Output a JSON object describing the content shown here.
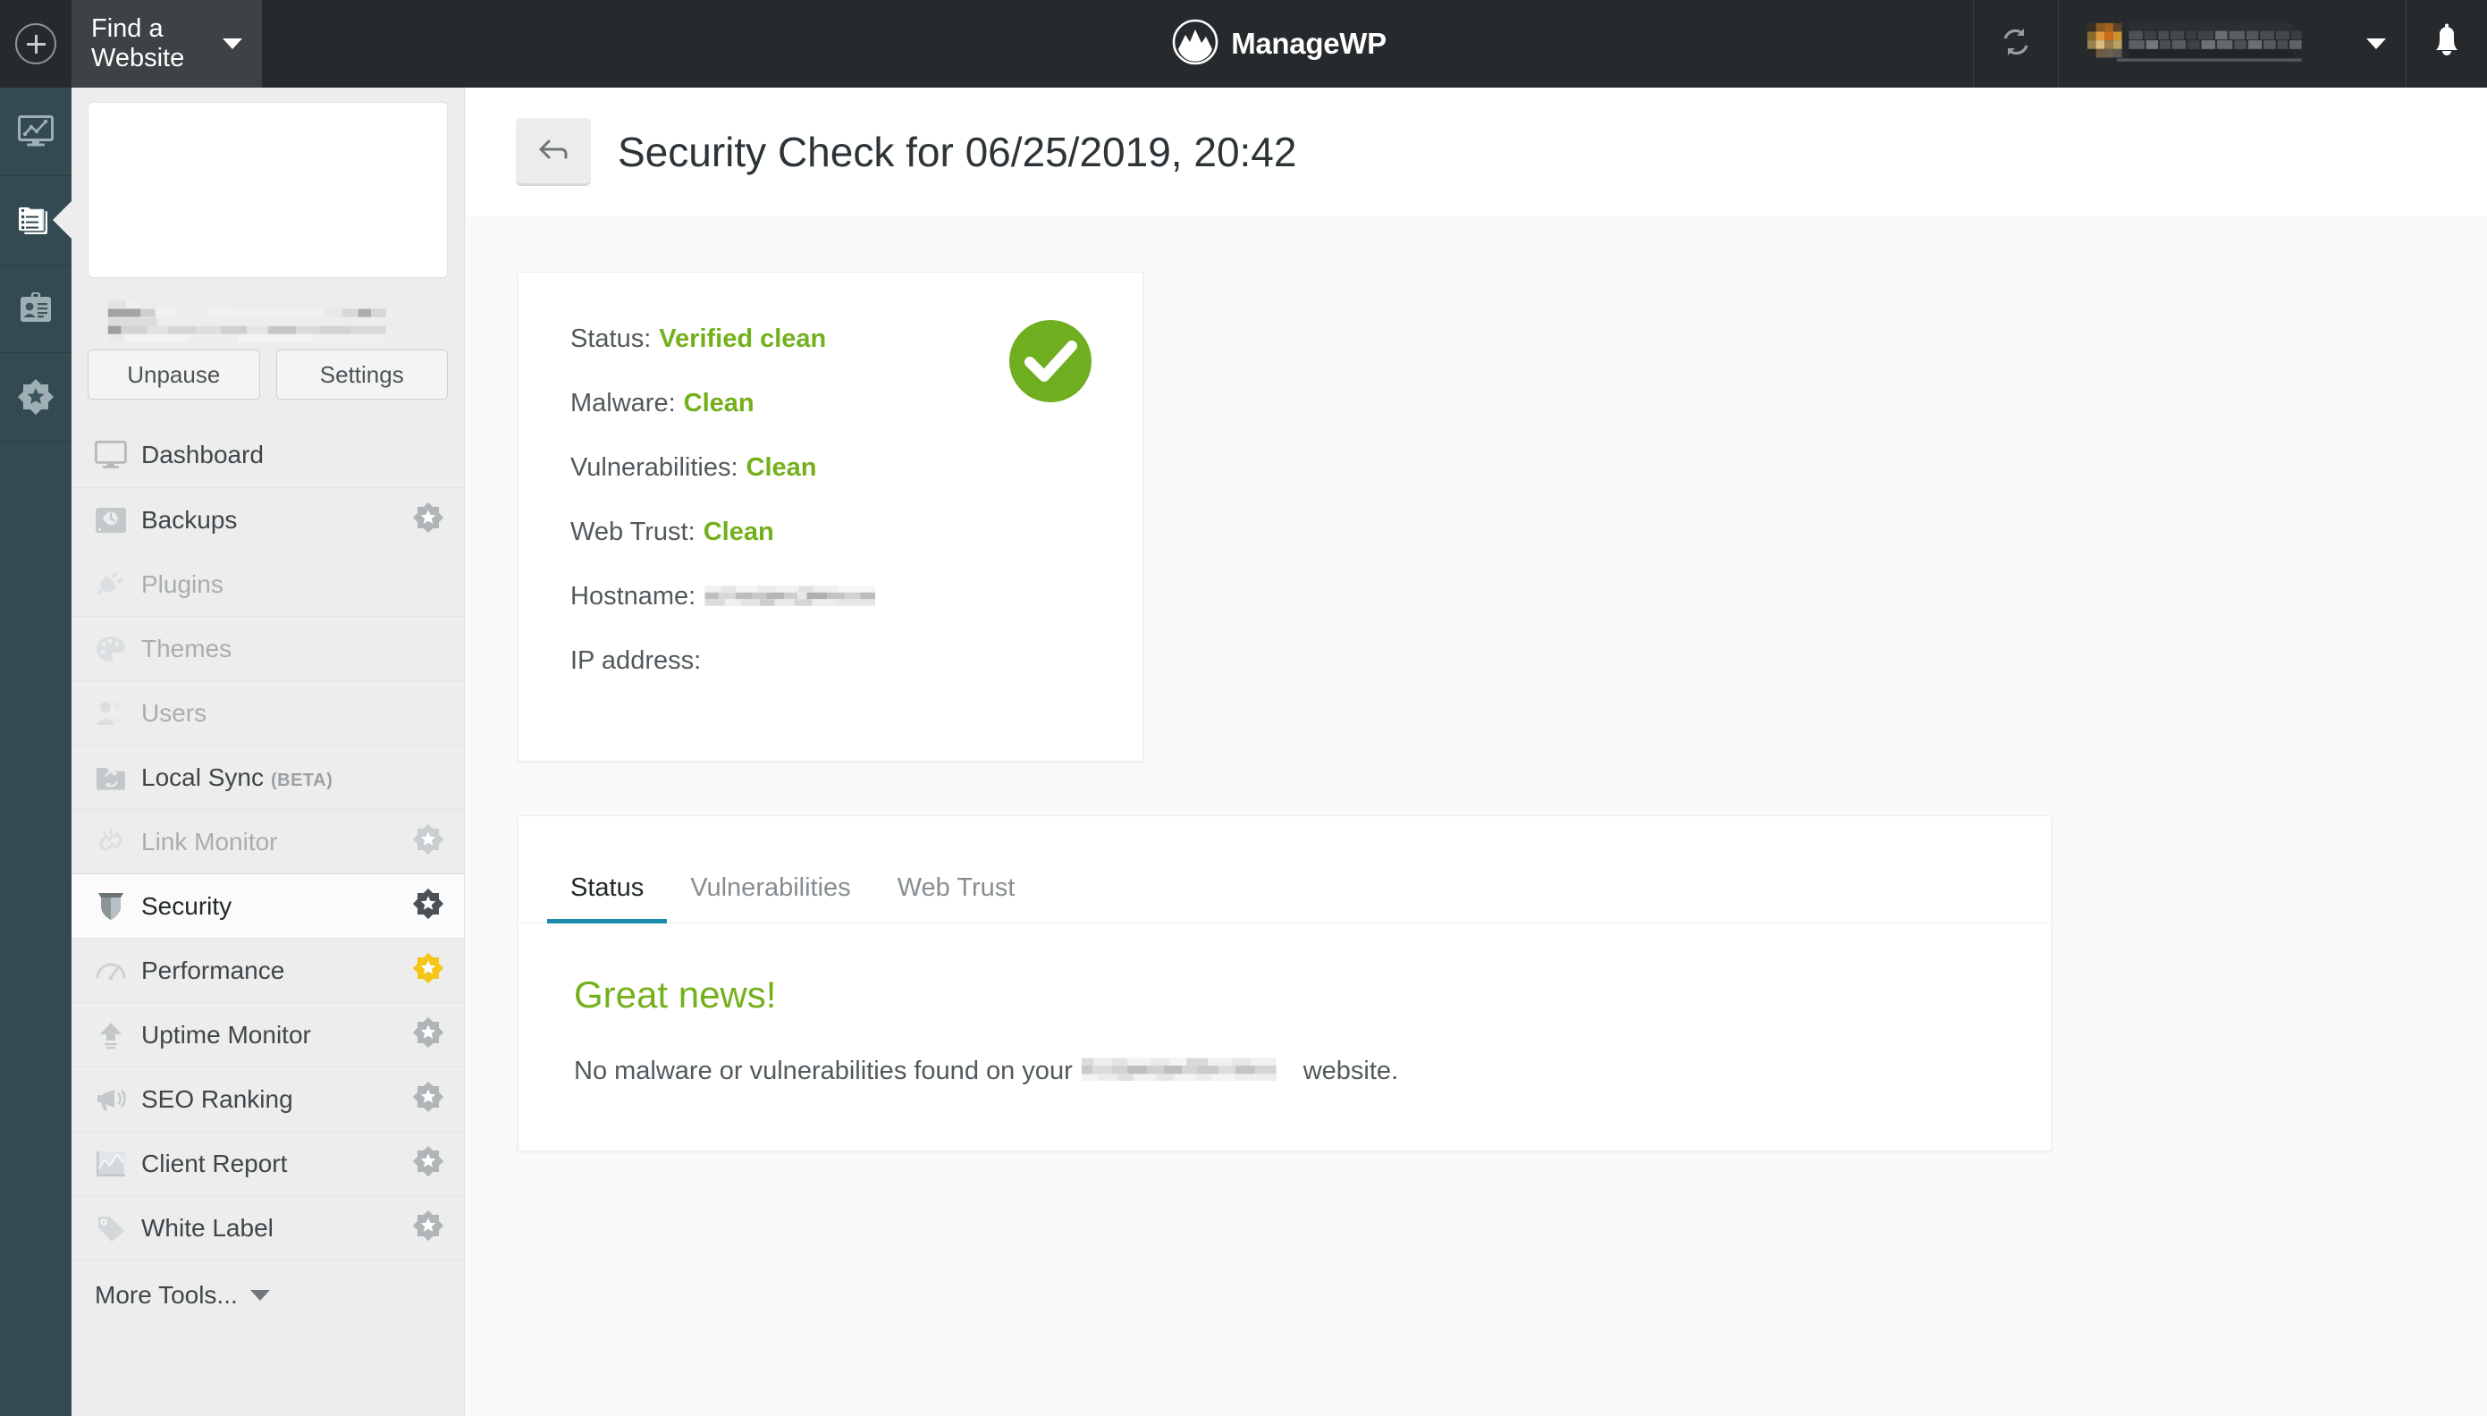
{
  "header": {
    "brand": "ManageWP",
    "brand_icon": "managewp-logo-icon",
    "find_site_label": "Find a Website",
    "find_site_caret_icon": "chevron-down-icon",
    "refresh_icon": "refresh-sync-icon",
    "user_caret_icon": "chevron-down-icon",
    "notifications_icon": "bell-icon",
    "add_website_icon": "plus-circle-icon",
    "bg_color": "#262a2d",
    "find_site_bg": "#3d4245"
  },
  "rail": {
    "bg_color": "#344a52",
    "items": [
      {
        "name": "overview",
        "icon": "monitor-chart-icon",
        "active": false
      },
      {
        "name": "websites",
        "icon": "stacked-documents-icon",
        "active": true
      },
      {
        "name": "clients",
        "icon": "id-card-icon",
        "active": false
      },
      {
        "name": "addons",
        "icon": "star-badge-icon",
        "active": false
      }
    ]
  },
  "sidebar": {
    "bg_color": "#ededed",
    "thumbnail": "website-screenshot-placeholder",
    "site_name_redacted": true,
    "site_url_redacted": true,
    "buttons": {
      "unpause": "Unpause",
      "settings": "Settings"
    },
    "items": [
      {
        "label": "Dashboard",
        "icon": "monitor-icon",
        "disabled": false,
        "badge": "none",
        "active": false
      },
      {
        "label": "Backups",
        "icon": "backup-disk-icon",
        "disabled": false,
        "badge": "gray",
        "active": false
      },
      {
        "label": "Plugins",
        "icon": "plug-icon",
        "disabled": true,
        "badge": "none",
        "active": false
      },
      {
        "label": "Themes",
        "icon": "palette-icon",
        "disabled": true,
        "badge": "none",
        "active": false
      },
      {
        "label": "Users",
        "icon": "users-icon",
        "disabled": true,
        "badge": "none",
        "active": false
      },
      {
        "label": "Local Sync",
        "icon": "folder-sync-icon",
        "disabled": false,
        "badge": "none",
        "active": false,
        "tag": "(BETA)"
      },
      {
        "label": "Link Monitor",
        "icon": "broken-link-icon",
        "disabled": true,
        "badge": "gray",
        "active": false
      },
      {
        "label": "Security",
        "icon": "shield-icon",
        "disabled": false,
        "badge": "dark",
        "active": true
      },
      {
        "label": "Performance",
        "icon": "gauge-icon",
        "disabled": false,
        "badge": "gold",
        "active": false
      },
      {
        "label": "Uptime Monitor",
        "icon": "up-arrow-icon",
        "disabled": false,
        "badge": "gray",
        "active": false
      },
      {
        "label": "SEO Ranking",
        "icon": "megaphone-icon",
        "disabled": false,
        "badge": "gray",
        "active": false
      },
      {
        "label": "Client Report",
        "icon": "report-chart-icon",
        "disabled": false,
        "badge": "gray",
        "active": false
      },
      {
        "label": "White Label",
        "icon": "tag-icon",
        "disabled": false,
        "badge": "gray",
        "active": false
      }
    ],
    "more_tools": "More Tools...",
    "more_tools_caret_icon": "chevron-down-icon"
  },
  "page": {
    "back_icon": "arrow-left-icon",
    "title": "Security Check for 06/25/2019, 20:42"
  },
  "status_card": {
    "check_icon": "green-check-circle-icon",
    "accent_green": "#74b01b",
    "rows": [
      {
        "label": "Status:",
        "value": "Verified clean",
        "redacted": false
      },
      {
        "label": "Malware:",
        "value": "Clean",
        "redacted": false
      },
      {
        "label": "Vulnerabilities:",
        "value": "Clean",
        "redacted": false
      },
      {
        "label": "Web Trust:",
        "value": "Clean",
        "redacted": false
      },
      {
        "label": "Hostname:",
        "value": "",
        "redacted": true
      },
      {
        "label": "IP address:",
        "value": "",
        "redacted": false
      }
    ]
  },
  "tabs_card": {
    "active_tab_color": "#1b8aa8",
    "tabs": [
      {
        "label": "Status",
        "active": true
      },
      {
        "label": "Vulnerabilities",
        "active": false
      },
      {
        "label": "Web Trust",
        "active": false
      }
    ],
    "heading": "Great news!",
    "body_prefix": "No malware or vulnerabilities found on your",
    "body_site_redacted": true,
    "body_suffix": "website."
  }
}
